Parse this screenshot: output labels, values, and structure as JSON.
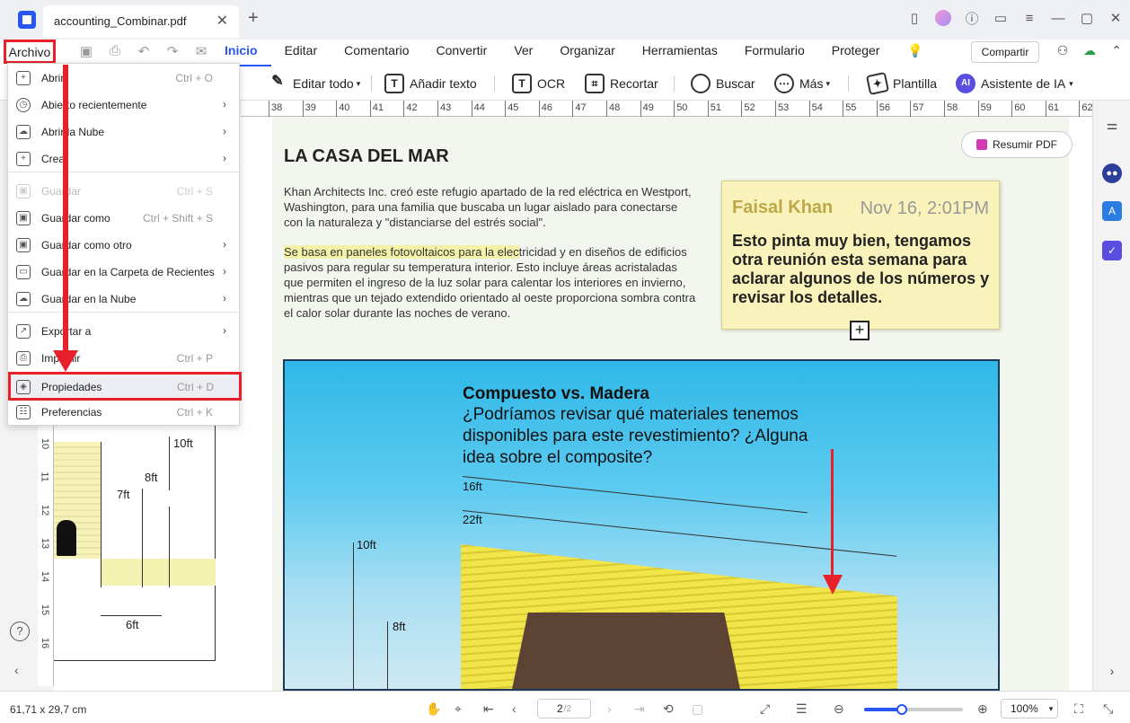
{
  "titlebar": {
    "tab_title": "accounting_Combinar.pdf",
    "tab_close": "✕",
    "tab_add": "+",
    "window_icons": [
      "tablet-icon",
      "avatar",
      "help-icon",
      "feedback-icon",
      "menu-icon",
      "minimize-icon",
      "maximize-icon",
      "close-icon"
    ]
  },
  "menubar": {
    "archivo": "Archivo",
    "tabs": [
      "Inicio",
      "Editar",
      "Comentario",
      "Convertir",
      "Ver",
      "Organizar",
      "Herramientas",
      "Formulario",
      "Proteger"
    ],
    "active_tab": "Inicio",
    "share": "Compartir"
  },
  "toolbar": {
    "edit_all": "Editar todo",
    "add_text": "Añadir texto",
    "ocr": "OCR",
    "crop": "Recortar",
    "search": "Buscar",
    "more": "Más",
    "template": "Plantilla",
    "ai_assistant": "Asistente de IA"
  },
  "ruler": {
    "numbers": [
      "38",
      "39",
      "40",
      "41",
      "42",
      "43",
      "44",
      "45",
      "46",
      "47",
      "48",
      "49",
      "50",
      "51",
      "52",
      "53",
      "54",
      "55",
      "56",
      "57",
      "58",
      "59",
      "60",
      "61",
      "62"
    ],
    "vertical": [
      "10",
      "11",
      "12",
      "13",
      "14",
      "15",
      "16"
    ]
  },
  "archivo_menu": {
    "items": [
      {
        "label": "Abrir",
        "shortcut": "Ctrl + O",
        "arrow": "",
        "icon": "open-icon",
        "disabled": false
      },
      {
        "label": "Abierto recientemente",
        "shortcut": "",
        "arrow": "›",
        "icon": "clock-icon",
        "disabled": false
      },
      {
        "label": "Abrir la Nube",
        "shortcut": "",
        "arrow": "›",
        "icon": "cloud-icon",
        "disabled": false
      },
      {
        "label": "Crear",
        "shortcut": "",
        "arrow": "›",
        "icon": "create-icon",
        "disabled": false
      },
      {
        "label": "Guardar",
        "shortcut": "Ctrl + S",
        "arrow": "",
        "icon": "save-icon",
        "disabled": true
      },
      {
        "label": "Guardar como",
        "shortcut": "Ctrl + Shift + S",
        "arrow": "",
        "icon": "save-as-icon",
        "disabled": false
      },
      {
        "label": "Guardar como otro",
        "shortcut": "",
        "arrow": "›",
        "icon": "save-other-icon",
        "disabled": false
      },
      {
        "label": "Guardar en la Carpeta de Recientes",
        "shortcut": "",
        "arrow": "›",
        "icon": "folder-icon",
        "disabled": false
      },
      {
        "label": "Guardar en la Nube",
        "shortcut": "",
        "arrow": "›",
        "icon": "cloud-save-icon",
        "disabled": false
      },
      {
        "label": "Exportar a",
        "shortcut": "",
        "arrow": "›",
        "icon": "export-icon",
        "disabled": false
      },
      {
        "label": "Imprimir",
        "shortcut": "Ctrl + P",
        "arrow": "",
        "icon": "print-icon",
        "disabled": false
      },
      {
        "label": "Propiedades",
        "shortcut": "Ctrl + D",
        "arrow": "",
        "icon": "properties-icon",
        "disabled": false
      },
      {
        "label": "Preferencias",
        "shortcut": "Ctrl + K",
        "arrow": "",
        "icon": "preferences-icon",
        "disabled": false
      }
    ],
    "highlighted": "Propiedades"
  },
  "document": {
    "title": "LA CASA DEL MAR",
    "para1": "Khan Architects Inc. creó este refugio apartado de la red eléctrica en Westport, Washington, para una familia que buscaba un lugar aislado para conectarse con la naturaleza y \"distanciarse del estrés social\".",
    "para2_highlight": "Se basa en paneles fotovoltaicos para la elec",
    "para2_rest": "tricidad y en diseños de edificios pasivos para regular su temperatura interior. Esto incluye áreas acristaladas que permiten el ingreso de la luz solar para calentar los interiores en invierno, mientras que un tejado extendido orientado al oeste proporciona sombra contra el calor solar durante las noches de verano.",
    "summarize": "Resumir PDF",
    "note_author": "Faisal Khan",
    "note_date": "Nov 16, 2:01PM",
    "note_text": "Esto pinta muy bien, tengamos otra reunión esta semana para aclarar algunos de los números y revisar los detalles.",
    "image_title": "Compuesto vs. Madera",
    "image_text": "¿Podríamos revisar qué materiales tenemos disponibles para este revestimiento? ¿Alguna idea sobre el composite?",
    "image_dims": [
      "16ft",
      "22ft",
      "10ft",
      "8ft"
    ],
    "left_dims": [
      "10ft",
      "8ft",
      "7ft",
      "6ft"
    ]
  },
  "statusbar": {
    "dimensions": "61,71 x 29,7 cm",
    "page_current": "2",
    "page_total": "/2",
    "zoom": "100%",
    "zoom_level": 0.38
  },
  "colors": {
    "accent": "#2756f5",
    "annotation_red": "#e8202a",
    "note_bg": "#f9f2ba"
  }
}
